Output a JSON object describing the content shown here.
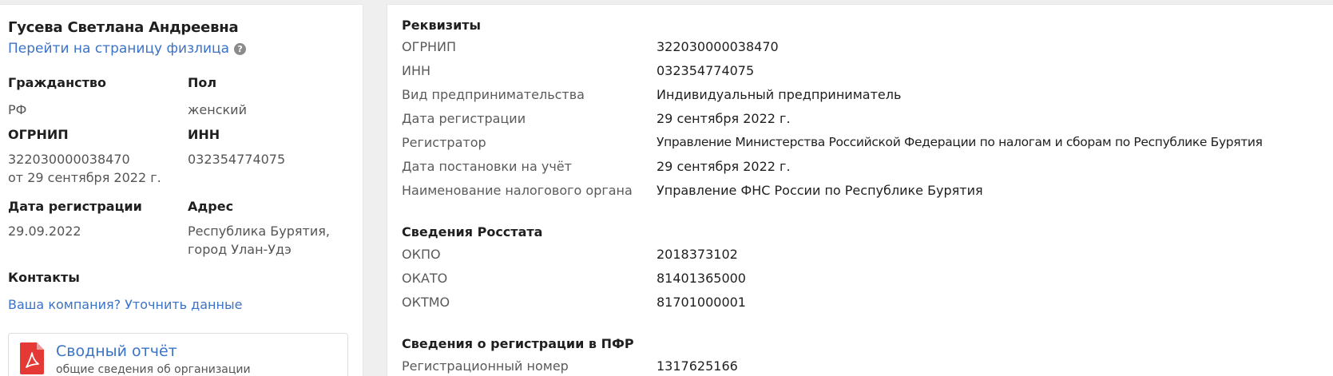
{
  "left": {
    "name": "Гусева Светлана Андреевна",
    "person_link": "Перейти на страницу физлица",
    "help_glyph": "?",
    "citizenship_label": "Гражданство",
    "citizenship_value": "РФ",
    "gender_label": "Пол",
    "gender_value": "женский",
    "ogrnip_label": "ОГРНИП",
    "ogrnip_value": "322030000038470",
    "ogrnip_date": "от 29 сентября 2022 г.",
    "inn_label": "ИНН",
    "inn_value": "032354774075",
    "regdate_label": "Дата регистрации",
    "regdate_value": "29.09.2022",
    "address_label": "Адрес",
    "address_line1": "Республика Бурятия,",
    "address_line2": "город Улан-Удэ",
    "contacts_label": "Контакты",
    "clarify_link": "Ваша компания? Уточнить данные",
    "report_title": "Сводный отчёт",
    "report_subtitle": "общие сведения об организации",
    "pdf_icon_color": "#e53935"
  },
  "requisites": {
    "title": "Реквизиты",
    "rows": [
      {
        "label": "ОГРНИП",
        "value": "322030000038470"
      },
      {
        "label": "ИНН",
        "value": "032354774075"
      },
      {
        "label": "Вид предпринимательства",
        "value": "Индивидуальный предприниматель"
      },
      {
        "label": "Дата регистрации",
        "value": "29 сентября 2022 г."
      },
      {
        "label": "Регистратор",
        "value": "Управление Министерства Российской Федерации по налогам и сборам по Республике Бурятия"
      },
      {
        "label": "Дата постановки на учёт",
        "value": "29 сентября 2022 г."
      },
      {
        "label": "Наименование налогового органа",
        "value": "Управление ФНС России по Республике Бурятия"
      }
    ]
  },
  "rosstat": {
    "title": "Сведения Росстата",
    "rows": [
      {
        "label": "ОКПО",
        "value": "2018373102"
      },
      {
        "label": "ОКАТО",
        "value": "81401365000"
      },
      {
        "label": "ОКТМО",
        "value": "81701000001"
      }
    ]
  },
  "pfr": {
    "title": "Сведения о регистрации в ПФР",
    "rows": [
      {
        "label": "Регистрационный номер",
        "value": "1317625166"
      }
    ]
  },
  "colors": {
    "link": "#3b73c7",
    "page_bg": "#efefef",
    "card_bg": "#ffffff"
  }
}
